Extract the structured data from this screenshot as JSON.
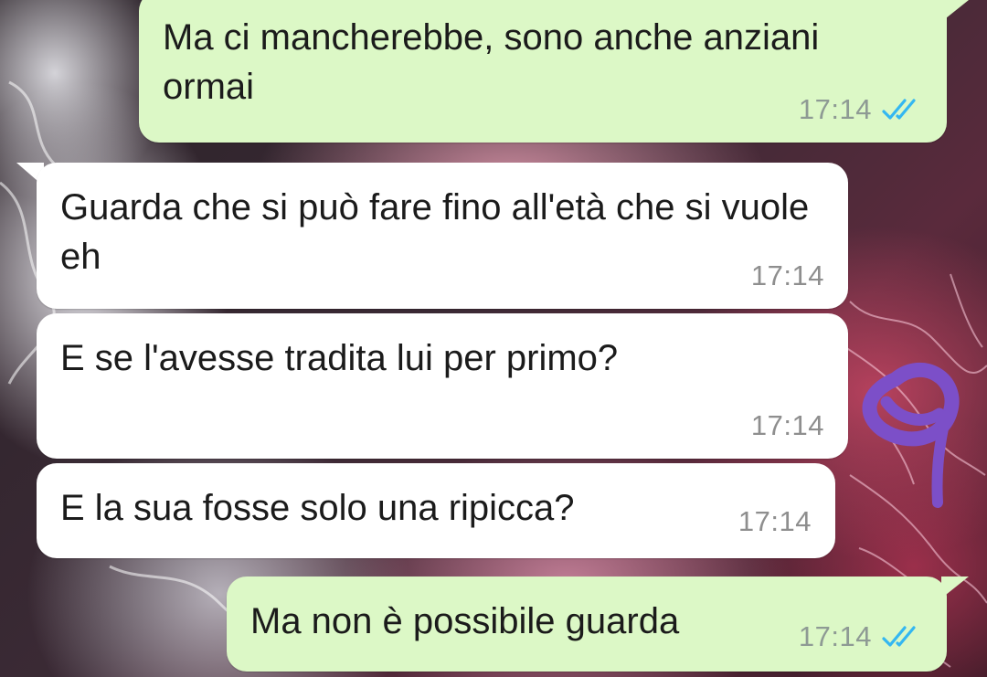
{
  "colors": {
    "outgoing_bubble": "#dcf8c6",
    "incoming_bubble": "#ffffff",
    "read_ticks": "#34b7f1",
    "doodle": "#7c4fc8"
  },
  "messages": [
    {
      "direction": "outgoing",
      "text": "Ma ci mancherebbe, sono anche anziani ormai",
      "time": "17:14",
      "status": "read",
      "status_icon": "double-check-icon"
    },
    {
      "direction": "incoming",
      "text": "Guarda che si può fare fino all'età che si vuole eh",
      "time": "17:14"
    },
    {
      "direction": "incoming",
      "text": "E se l'avesse tradita lui per primo?",
      "time": "17:14"
    },
    {
      "direction": "incoming",
      "text": "E la sua fosse solo una ripicca?",
      "time": "17:14"
    },
    {
      "direction": "outgoing",
      "text": "Ma non è possibile guarda",
      "time": "17:14",
      "status": "read",
      "status_icon": "double-check-icon"
    }
  ]
}
